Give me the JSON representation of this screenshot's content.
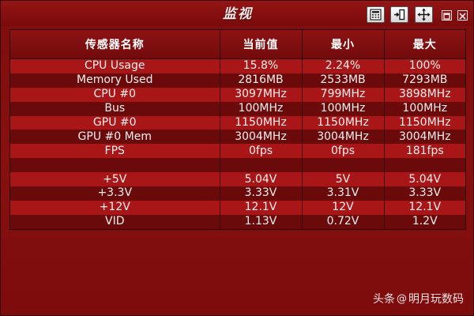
{
  "window": {
    "title": "监视"
  },
  "toolbar": {
    "icons": [
      "calculator-icon",
      "panel-expand-icon",
      "move-icon"
    ],
    "window_buttons": [
      "restore-icon",
      "close-icon"
    ]
  },
  "colors": {
    "background": "#86100f",
    "row_light": "#a91617",
    "row_dark": "#6b0a0b",
    "text": "#f4f0f0"
  },
  "table": {
    "headers": [
      "传感器名称",
      "当前值",
      "最小",
      "最大"
    ],
    "rows": [
      [
        "CPU Usage",
        "15.8%",
        "2.24%",
        "100%"
      ],
      [
        "Memory Used",
        "2816MB",
        "2533MB",
        "7293MB"
      ],
      [
        "CPU #0",
        "3097MHz",
        "799MHz",
        "3898MHz"
      ],
      [
        "Bus",
        "100MHz",
        "100MHz",
        "100MHz"
      ],
      [
        "GPU #0",
        "1150MHz",
        "1150MHz",
        "1150MHz"
      ],
      [
        "GPU #0 Mem",
        "3004MHz",
        "3004MHz",
        "3004MHz"
      ],
      [
        "FPS",
        "0fps",
        "0fps",
        "181fps"
      ],
      [
        "",
        "",
        "",
        ""
      ],
      [
        "+5V",
        "5.04V",
        "5V",
        "5.04V"
      ],
      [
        "+3.3V",
        "3.33V",
        "3.31V",
        "3.33V"
      ],
      [
        "+12V",
        "12.1V",
        "12V",
        "12.1V"
      ],
      [
        "VID",
        "1.13V",
        "0.72V",
        "1.2V"
      ]
    ]
  },
  "watermark": {
    "brand": "头条",
    "at": "@",
    "account": "明月玩数码"
  }
}
